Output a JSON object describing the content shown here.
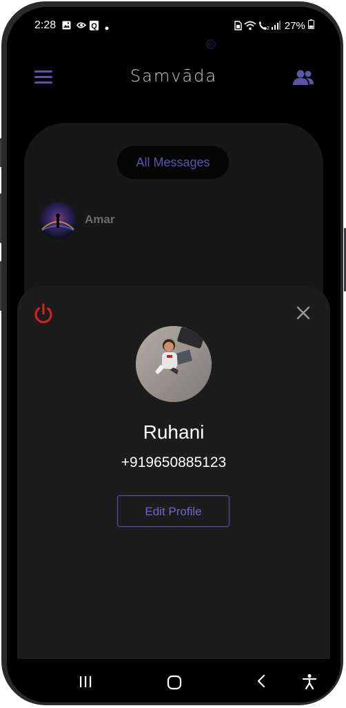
{
  "status_bar": {
    "time": "2:28",
    "battery": "27%",
    "icons": [
      "gallery-icon",
      "bluetooth-icon",
      "q-app-icon",
      "dot-icon",
      "sim-icon",
      "wifi-icon",
      "volte-call-icon",
      "signal-icon",
      "battery-icon"
    ]
  },
  "app_bar": {
    "title": "Samvāda",
    "menu_icon": "hamburger-menu-icon",
    "contacts_icon": "contacts-group-icon"
  },
  "chats": {
    "filter_label": "All Messages",
    "items": [
      {
        "name": "Amar"
      }
    ]
  },
  "profile_sheet": {
    "name": "Ruhani",
    "phone": "+919650885123",
    "edit_button": "Edit Profile",
    "power_icon": "power-icon",
    "close_icon": "close-icon"
  },
  "nav_bar": {
    "buttons": [
      "recent-apps-icon",
      "home-icon",
      "back-icon",
      "accessibility-icon"
    ]
  },
  "colors": {
    "accent": "#5a55b2",
    "power": "#e02020",
    "background": "#000000",
    "sheet": "#1c1c1c"
  }
}
